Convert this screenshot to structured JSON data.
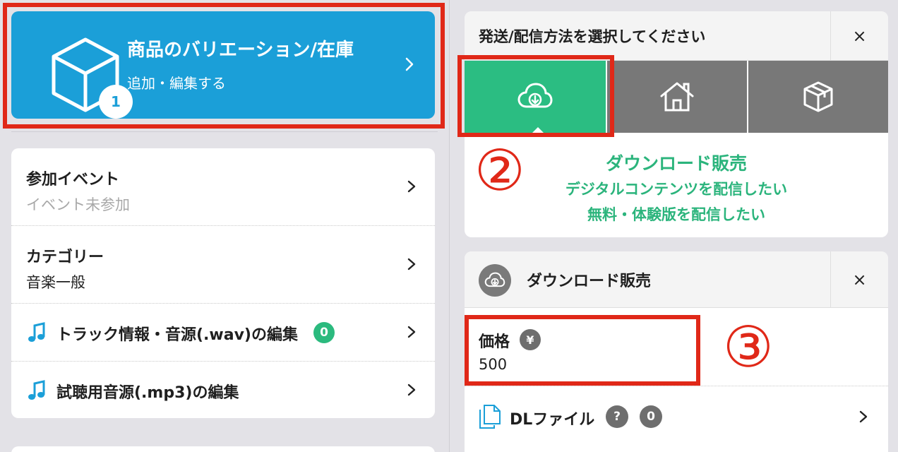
{
  "variation_card": {
    "title": "商品のバリエーション/在庫",
    "subtitle": "追加・編集する",
    "badge_count": "1",
    "icon": "cube-icon"
  },
  "annotations": {
    "marker_1": "①",
    "marker_2": "②",
    "marker_3": "③",
    "highlight_color": "#e02818"
  },
  "settings_list": [
    {
      "title": "参加イベント",
      "subtitle": "イベント未参加"
    },
    {
      "title": "カテゴリー",
      "subtitle": "音楽一般"
    },
    {
      "title": "トラック情報・音源(.wav)の編集",
      "badge": "0",
      "icon": "music-note-icon"
    },
    {
      "title": "試聴用音源(.mp3)の編集",
      "icon": "music-note-icon"
    }
  ],
  "shipping": {
    "title": "発送/配信方法を選択してください",
    "close_label": "×",
    "tabs": [
      {
        "icon": "cloud-download-icon",
        "selected": true
      },
      {
        "icon": "home-icon",
        "selected": false
      },
      {
        "icon": "package-icon",
        "selected": false
      }
    ],
    "selected_name": "ダウンロード販売",
    "desc_line1": "デジタルコンテンツを配信したい",
    "desc_line2": "無料・体験版を配信したい",
    "accent_color": "#2bbd82"
  },
  "download_sale": {
    "title": "ダウンロード販売",
    "close_label": "×",
    "price_label": "価格",
    "currency_symbol": "¥",
    "price_value": "500",
    "file_label": "DLファイル",
    "help_badge": "?",
    "file_count": "0"
  }
}
